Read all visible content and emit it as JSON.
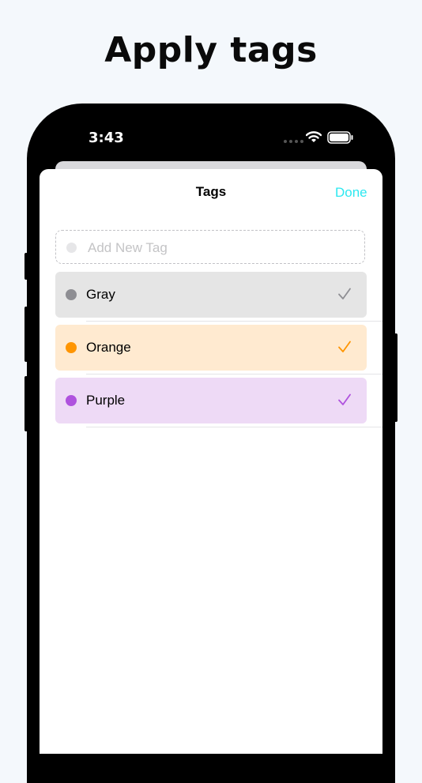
{
  "headline": "Apply tags",
  "status_bar": {
    "time": "3:43"
  },
  "sheet": {
    "title": "Tags",
    "done_label": "Done"
  },
  "add_tag": {
    "placeholder": "Add New Tag"
  },
  "tags": [
    {
      "label": "Gray",
      "color": "#8e8e93",
      "bg": "#e5e5e5",
      "selected": true
    },
    {
      "label": "Orange",
      "color": "#ff9500",
      "bg": "#ffead0",
      "selected": true
    },
    {
      "label": "Purple",
      "color": "#af52de",
      "bg": "#eedaf6",
      "selected": true
    }
  ],
  "colors": {
    "accent": "#2de8f0"
  }
}
